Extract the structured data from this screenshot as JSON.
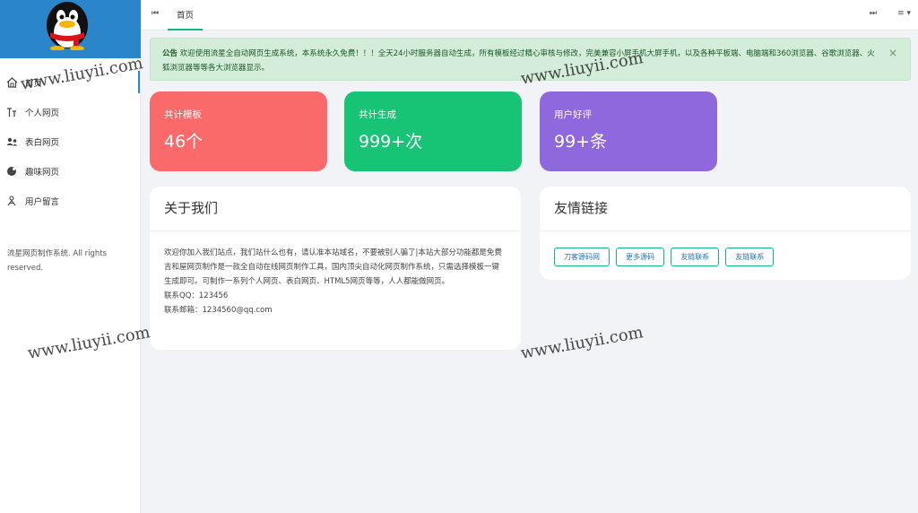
{
  "sidebar": {
    "items": [
      {
        "label": "首页",
        "icon": "home-icon"
      },
      {
        "label": "个人网页",
        "icon": "person-page-icon"
      },
      {
        "label": "表白网页",
        "icon": "users-icon"
      },
      {
        "label": "趣味网页",
        "icon": "fun-icon"
      },
      {
        "label": "用户留言",
        "icon": "message-icon"
      }
    ],
    "copyright": "流星网页制作系统. All rights reserved."
  },
  "topbar": {
    "tab_home": "首页",
    "nav_prev": "⏮",
    "nav_next": "⏭",
    "menu": "≡ ▾"
  },
  "notice": {
    "label": "公告",
    "text": "欢迎使用流星全自动网页生成系统，本系统永久免费！！！全天24小时服务器自动生成，所有模板经过精心审核与修改，完美兼容小屏手机大屏手机，以及各种平板端、电脑端和360浏览器、谷歌浏览器、火狐浏览器等等各大浏览器显示。",
    "close": "×"
  },
  "stats": [
    {
      "label": "共计模板",
      "value": "46个",
      "color": "#fb6a6a"
    },
    {
      "label": "共计生成",
      "value": "999+次",
      "color": "#17c475"
    },
    {
      "label": "用户好评",
      "value": "99+条",
      "color": "#9068de"
    }
  ],
  "about": {
    "title": "关于我们",
    "body": "欢迎你加入我们站点，我们站什么也有，请认准本站域名，不要被别人骗了|本站大部分功能都是免费 吉和屋网页制作是一款全自动在线网页制作工具，国内顶尖自动化网页制作系统，只需选择模板一键生成即可。可制作一系列个人网页、表白网页、HTML5网页等等，人人都能做网页。",
    "qq": "联系QQ：123456",
    "email": "联系邮箱：1234560@qq.com"
  },
  "links": {
    "title": "友情链接",
    "items": [
      "刀客源码网",
      "更多源码",
      "友链联系",
      "友链联系"
    ]
  },
  "watermark": "www.liuyii.com"
}
